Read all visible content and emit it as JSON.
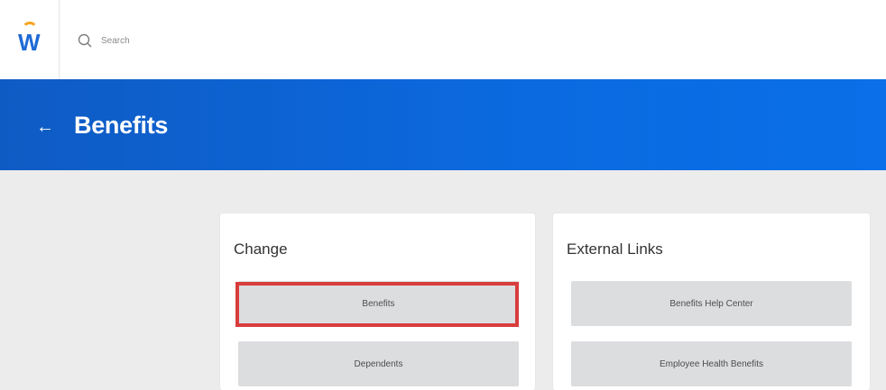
{
  "app": {
    "logo_letter": "W"
  },
  "search": {
    "placeholder": "Search",
    "icon": "search-icon"
  },
  "header": {
    "back_icon": "←",
    "title": "Benefits"
  },
  "cards": {
    "change": {
      "title": "Change",
      "buttons": [
        "Benefits",
        "Dependents"
      ]
    },
    "external_links": {
      "title": "External Links",
      "buttons": [
        "Benefits Help Center",
        "Employee Health Benefits"
      ]
    }
  },
  "colors": {
    "header_blue": "#0b6ae0",
    "highlight_red": "#d83d3d",
    "logo_orange": "#f5a623"
  }
}
